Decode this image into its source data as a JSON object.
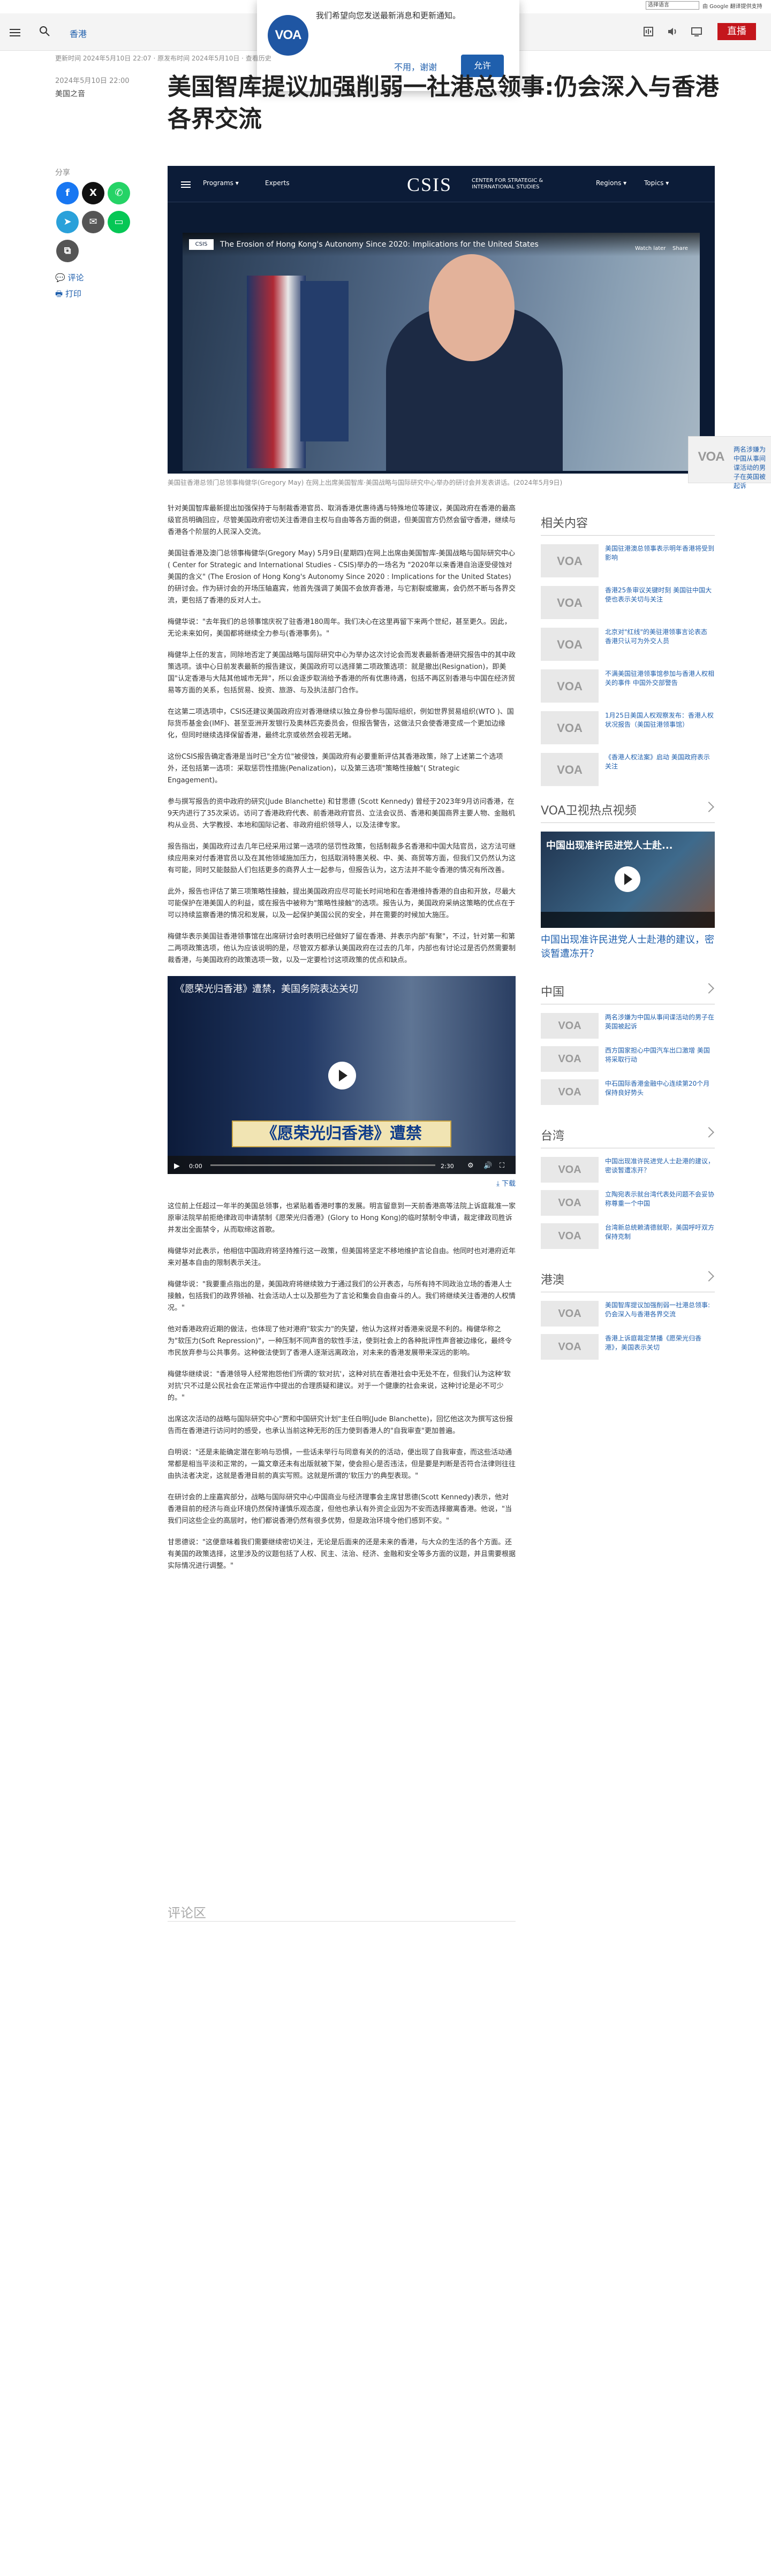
{
  "translate": {
    "select_label": "选择语言",
    "powered": "由 Google 翻译提供支持"
  },
  "header": {
    "site_name": "香港",
    "live_label": "直播"
  },
  "popup": {
    "message": "我们希望向您发送最新消息和更新通知。",
    "no_label": "不用，谢谢",
    "yes_label": "允许",
    "logo_text": "VOA"
  },
  "article": {
    "updated": "更新时间 2024年5月10日 22:07 · 原发布时间 2024年5月10日 · 查看历史",
    "published": "2024年5月10日 22:00",
    "author": "美国之音",
    "title": "美国智库提议加强削弱一社港总领事:仍会深入与香港各界交流"
  },
  "share": {
    "label": "分享",
    "comment": "评论",
    "print": "打印"
  },
  "figure": {
    "csis_nav": [
      "Programs ▾",
      "Experts",
      "Regions ▾",
      "Topics ▾"
    ],
    "csis_name": "CSIS",
    "csis_sub": "CENTER FOR STRATEGIC & INTERNATIONAL STUDIES",
    "video_title": "The Erosion of Hong Kong's Autonomy Since 2020: Implications for the United States",
    "watch_later": "Watch later",
    "share_label": "Share",
    "caption": "美国驻香港总领门总领事梅健华(Gregory May) 在网上出席美国智库·美国战略与国际研究中心举办的研讨会并发表讲话。(2024年5月9日)"
  },
  "paragraphs_1": [
    "针对美国智库最新提出加强保持于与制裁香港官员、取消香港优惠待遇与特殊地位等建议，美国政府在香港的最高级官员明确回应，尽管美国政府密切关注香港自主权与自由等各方面的倒退，但美国官方仍然会留守香港，继续与香港各个阶层的人民深入交流。",
    "美国驻香港及澳门总领事梅健华(Gregory May) 5月9日(星期四)在网上出席由美国智库-美国战略与国际研究中心( Center for Strategic and International Studies - CSIS)举办的一场名为 \"2020年以来香港自治逐受侵蚀对美国的含义\" (The Erosion of Hong Kong's Autonomy Since 2020 : Implications for the United States)的研讨会。作为研讨会的开场压轴嘉宾，他首先强调了美国不会放弃香港，与它割裂或撤离，会仍然不断与各界交流，更包括了香港的反对人士。",
    "梅健华说：\"去年我们的总领事馆庆祝了驻香港180周年。我们决心在这里再留下来两个世纪，甚至更久。因此，无论未来如何，美国都将继续全力参与(香港事务)。\"",
    "梅健华上任的发言，同除地否定了美国战略与国际研究中心为举办这次讨论会而发表最新香港研究报告中的其中政策选项。该中心日前发表最新的报告建议，美国政府可以选择第二项政策选项：就是撤出(Resignation)，即美国\"认定香港与大陆其他城市无异\"，所以会逐步取消给予香港的所有优惠待遇，包括不再区别香港与中国在经济贸易等方面的关系，包括贸易、投资、旅游、与及执法部门合作。",
    "在这第二项选项中，CSIS还建议美国政府应对香港继续以独立身份参与国际组织，例如世界贸易组织(WTO )、国际货币基金会(IMF)、甚至亚洲开发银行及奥林匹克委员会，但报告警告，这做法只会使香港变成一个更加边缘化，但同时继续选择保留香港，最终北京或依然会视若无睹。",
    "这份CSIS报告确定香港是当时已\"全方位\"被侵蚀，美国政府有必要重新评估其香港政策，除了上述第二个选项外，还包括第一选项：采取惩罚性措施(Penalization)，以及第三选项\"策略性接触\"( Strategic Engagement)。",
    "参与撰写报告的资中政府的研究(Jude Blanchette) 和甘思德 (Scott Kennedy) 曾经于2023年9月访问香港，在9天内进行了35次采访。访问了香港政府代表、前香港政府官员、立法会议员、香港和美国商界主要人物、金融机构从业员、大学教授、本地和国际记者、非政府组织领导人，以及法律专家。",
    "报告指出，美国政府过去几年已经采用过第一选项的惩罚性政策，包括制裁多名香港和中国大陆官员，这方法可继续应用来对付香港官员以及在其他领域施加压力，包括取消特惠关税、中、美、商贸等方面，但我们又仍然认为这有可能，同时又能鼓励人们包括更多的商界人士一起参与，但报告认为，这方法并不能令香港的情况有所改善。",
    "此外，报告也评估了第三项策略性接触，提出美国政府应尽可能长时间地和在香港维持香港的自由和开放，尽最大可能保护在港美国人的利益，或在报告中被称为\"策略性接触\"的选项。报告认为，美国政府采纳这策略的优点在于可以持续监察香港的情况和发展，以及一起保护美国公民的安全，并在需要的时候加大施压。"
  ],
  "paragraphs_2": [
    "梅健华表示美国驻香港领事馆在出席研讨会时表明已经做好了留在香港、并表示内部\"有聚\"，不过，针对第一和第二两项政策选项，他认为应该说明的是，尽管双方都承认美国政府在过去的几年，内部也有讨论过是否仍然需要制裁香港，与美国政府的政策选项一致，以及一定要检讨这项政策的优点和缺点。"
  ],
  "video2": {
    "title": "《愿荣光归香港》遭禁，美国务院表达关切",
    "banner": "《愿荣光归香港》遭禁",
    "time": "0:00",
    "dur": "2:30",
    "download": "下载"
  },
  "paragraphs_3": [
    "这位前上任超过一年半的美国总领事，也紧贴着香港时事的发展。明言留意到一天前香港高等法院上诉庭裁准一家原审法院早前拒绝律政司申请禁制《愿荣光归香港》(Glory to Hong Kong)的临时禁制令申请，裁定律政司胜诉并发出全面禁令，从而取缔这首歌。",
    "梅健华对此表示，他相信中国政府将坚持推行这一政策，但美国将坚定不移地维护言论自由。他同时也对港府近年来对基本自由的限制表示关注。",
    "梅健华说：\"我要重点指出的是，美国政府将继续致力于通过我们的公开表态，与所有持不同政治立场的香港人士接触，包括我们的政界领袖、社会活动人士以及那些为了言论和集会自由奋斗的人。我们将继续关注香港的人权情况。\"",
    "他对香港政府近期的做法，也体现了他对港府\"软实力\"的失望，他认为这样对香港来说是不利的。梅健华称之为\"软压力(Soft Repression)\"，一种压制不同声音的软性手法，使到社会上的各种批评性声音被边缘化，最终令市民放弃参与公共事务。这种做法使到了香港人逐渐远离政治，对未来的香港发展带来深远的影响。",
    "梅健华继续说：\"香港领导人经常抱怨他们所谓的'软对抗'，这种对抗在香港社会中无处不在，但我们认为这种'软对抗'只不过是公民社会在正常运作中提出的合理质疑和建议。对于一个健康的社会来说，这种讨论是必不可少的。\"",
    "出席这次活动的战略与国际研究中心\"贾和中国研究计划\"主任白明(Jude Blanchette)，回忆他这次为撰写这份报告而在香港进行访问时的感受，也承认当前这种无形的压力使到香港人的\"自我审查\"更加普遍。",
    "白明说：\"还是未能确定潜在影响与恐惧，一些话未举行与同意有关的的活动，便出现了自我审查，而这些活动通常都是相当平淡和正常的，一篇文章还未有出版就被下架，使会担心是否违法，但是要是判断是否符合法律则往往由执法者决定，这就是香港目前的真实写照。这就是所谓的'软压力'的典型表现。\"",
    "在研讨会的上座嘉宾部分，战略与国际研究中心中国商业与经济理事会主席甘思德(Scott Kennedy)表示，他对香港目前的经济与商业环境仍然保持谨慎乐观态度，但他也承认有外资企业因为不安而选择撤离香港。他说，\"当我们问这些企业的高层时，他们都说香港仍然有很多优势，但是政治环境令他们感到不安。\"",
    "甘思德说：\"这便意味着我们需要继续密切关注，无论是后面来的还是未来的香港，与大众的生活的各个方面。还有美国的政策选择，这里涉及的议题包括了人权、民主、法治、经济、金融和安全等多方面的议题，并且需要根据实际情况进行调整。\""
  ],
  "comments_label": "评论区",
  "sidebar": {
    "related_title": "相关内容",
    "related": [
      "美国驻港澳总领事表示明年香港将受到影响",
      "香港25条审议关键时刻 美国驻中国大使也表示关切与关注",
      "北京对\"红线\"的美驻港领事言论表态 香港只认可为外交人员",
      "不满美国驻港领事馆参加与香港人权相关的事件 中国外交部警告",
      "1月25日美国人权观察发布：香港人权状况报告（美国驻港领事馆）",
      "《香港人权法案》启动 美国政府表示关注"
    ],
    "video_title": "VOA卫视热点视频",
    "video_caption": "中国出现准许民进党人士赴港的建议，密谈暂遭冻开？",
    "video_overlay": "中国出现准许民进党人士赴...",
    "china_title": "中国",
    "china": [
      "两名涉嫌为中国从事间谍活动的男子在英国被起诉",
      "西方国家担心中国汽车出口激增 美国将采取行动",
      "中石国际香港金融中心连续第20个月保持良好势头"
    ],
    "taiwan_title": "台湾",
    "taiwan": [
      "中国出现准许民进党人士赴港的建议，密谈暂遭冻开？",
      "立陶宛表示就台湾代表处问题不会妥协 称尊重一个中国",
      "台湾新总统赖清德就职，美国呼吁双方保持克制"
    ],
    "hk_title": "港澳",
    "hk": [
      "美国智库提议加强削弱一社港总领事:仍会深入与香港各界交流",
      "香港上诉庭裁定禁播《愿荣光归香港》，美国表示关切"
    ]
  },
  "float": {
    "text": "两名涉嫌为中国从事间谍活动的男子在英国被起诉"
  },
  "colors": {
    "accent": "#1f5fad",
    "live": "#c4161c",
    "voa": "#1f56a3"
  }
}
